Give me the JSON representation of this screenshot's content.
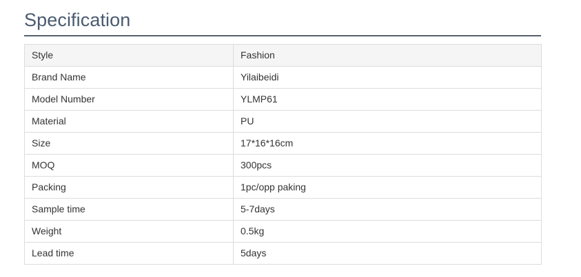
{
  "section": {
    "title": "Specification"
  },
  "specs": [
    {
      "label": "Style",
      "value": "Fashion"
    },
    {
      "label": "Brand Name",
      "value": "Yilaibeidi"
    },
    {
      "label": "Model Number",
      "value": "YLMP61"
    },
    {
      "label": "Material",
      "value": "PU"
    },
    {
      "label": "Size",
      "value": "17*16*16cm"
    },
    {
      "label": "MOQ",
      "value": "300pcs"
    },
    {
      "label": "Packing",
      "value": "1pc/opp paking"
    },
    {
      "label": "Sample time",
      "value": "5-7days"
    },
    {
      "label": "Weight",
      "value": "0.5kg"
    },
    {
      "label": "Lead time",
      "value": "5days"
    }
  ]
}
